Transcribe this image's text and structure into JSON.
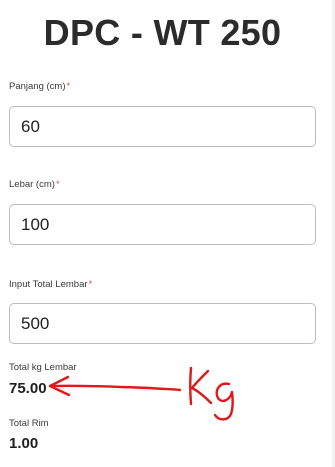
{
  "page": {
    "title": "DPC - WT 250"
  },
  "form": {
    "panjang": {
      "label": "Panjang (cm)",
      "required_mark": "*",
      "value": "60"
    },
    "lebar": {
      "label": "Lebar (cm)",
      "required_mark": "*",
      "value": "100"
    },
    "total_lembar": {
      "label": "Input Total Lembar",
      "required_mark": "*",
      "value": "500"
    }
  },
  "results": {
    "total_kg": {
      "label": "Total kg Lembar",
      "value": "75.00"
    },
    "total_rim": {
      "label": "Total Rim",
      "value": "1.00"
    }
  },
  "annotation": {
    "text": "Kg",
    "color": "#e01818"
  },
  "colors": {
    "required": "#e04b4b",
    "annotation": "#e01818"
  }
}
